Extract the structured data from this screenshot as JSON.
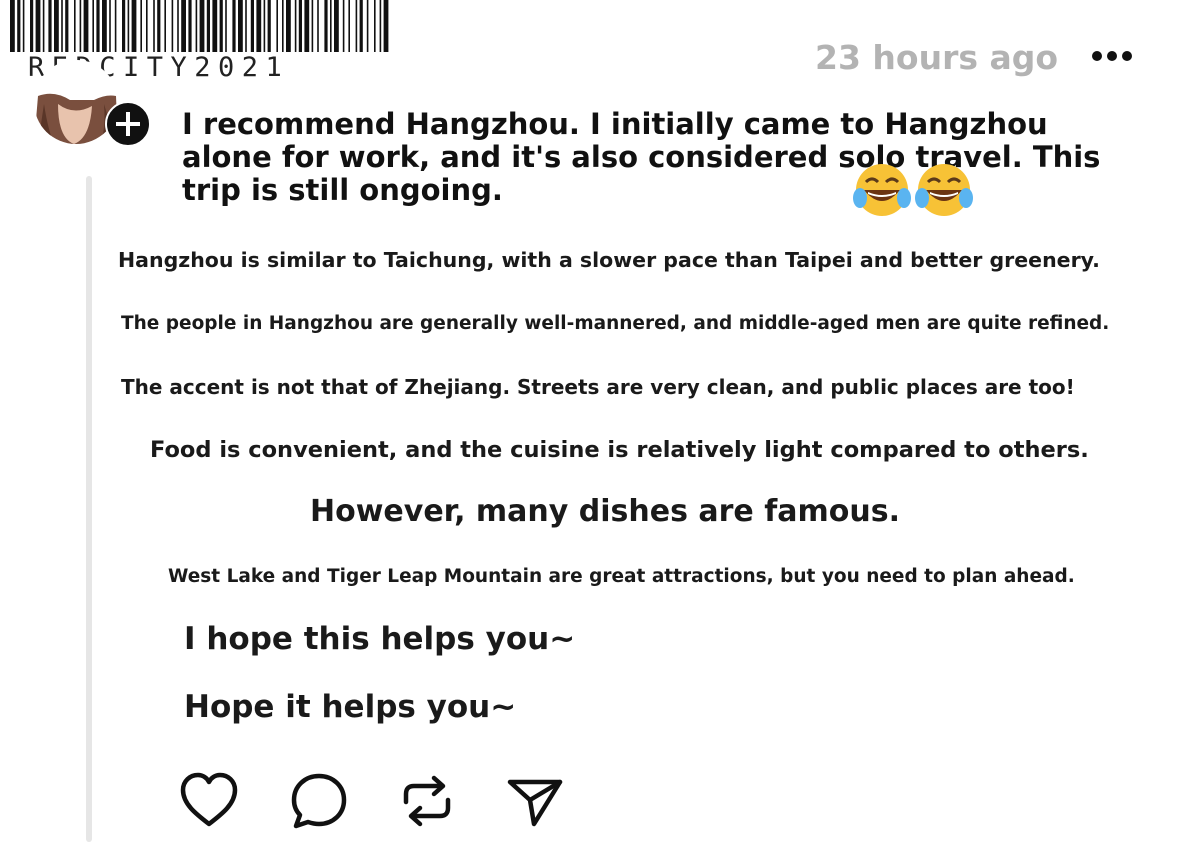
{
  "brand": {
    "barcode_text": "REDCITY2021"
  },
  "post": {
    "timestamp": "23 hours ago",
    "headline": "I recommend Hangzhou. I initially came to Hangzhou alone for work, and it's also considered solo travel. This trip is still ongoing.",
    "emoji": [
      "😂",
      "😂"
    ],
    "lines": [
      "Hangzhou is similar to Taichung, with a slower pace than Taipei and better greenery.",
      "The people in Hangzhou are generally well-mannered, and middle-aged men are quite refined.",
      "The accent is not that of Zhejiang. Streets are very clean, and public places are too!",
      "Food is convenient, and the cuisine is relatively light compared to others.",
      "However, many dishes are famous.",
      "West Lake and Tiger Leap Mountain are great attractions, but you need to plan ahead.",
      "I hope this helps you~",
      "Hope it helps you~"
    ]
  },
  "icons": {
    "more": "more-icon",
    "follow": "plus-icon",
    "like": "heart-icon",
    "comment": "comment-icon",
    "repost": "repost-icon",
    "share": "send-icon"
  },
  "colors": {
    "timestamp": "#b3b3b3",
    "text": "#111111",
    "follow_button": "#111111",
    "thread_line": "#e6e6e6"
  }
}
